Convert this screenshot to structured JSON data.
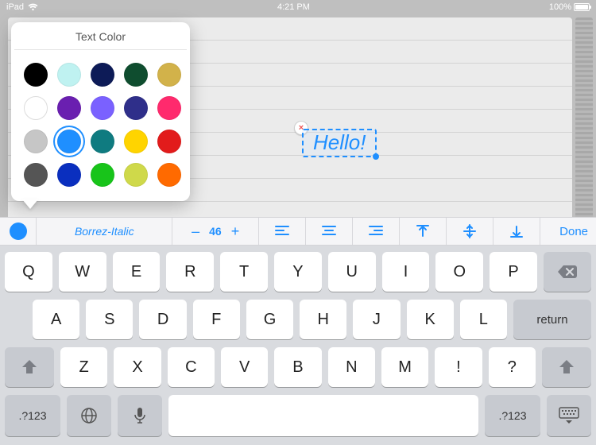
{
  "status": {
    "carrier": "iPad",
    "time": "4:21 PM",
    "battery_pct": "100%"
  },
  "document": {
    "text_value": "Hello!"
  },
  "popover": {
    "title": "Text Color",
    "selected_index": 11,
    "colors": [
      "#000000",
      "#bff2f1",
      "#0d1b57",
      "#0f4d2f",
      "#d2b24a",
      "#ffffff",
      "#6a1fb0",
      "#7a61ff",
      "#2f2f8a",
      "#ff2a6d",
      "#c6c6c6",
      "#1f8fff",
      "#0f7b80",
      "#ffd400",
      "#e21b1b",
      "#555555",
      "#0a2fbf",
      "#18c41a",
      "#cfd94a",
      "#ff6a00"
    ]
  },
  "toolbar": {
    "color": "#1f8fff",
    "font_name": "Borrez-Italic",
    "size_minus": "–",
    "size_value": "46",
    "size_plus": "+",
    "done_label": "Done"
  },
  "keyboard": {
    "row1": [
      "Q",
      "W",
      "E",
      "R",
      "T",
      "Y",
      "U",
      "I",
      "O",
      "P"
    ],
    "row2": [
      "A",
      "S",
      "D",
      "F",
      "G",
      "H",
      "J",
      "K",
      "L"
    ],
    "row3": [
      "Z",
      "X",
      "C",
      "V",
      "B",
      "N",
      "M",
      "!",
      "?"
    ],
    "return_label": "return",
    "mode_label": ".?123"
  }
}
